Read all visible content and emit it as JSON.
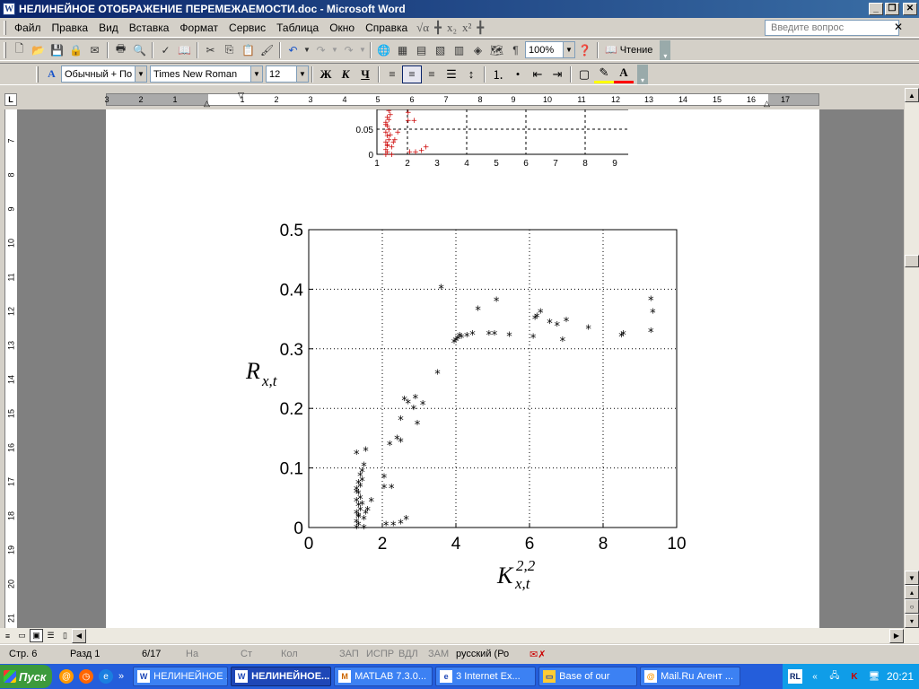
{
  "window": {
    "title": "НЕЛИНЕЙНОЕ ОТОБРАЖЕНИЕ ПЕРЕМЕЖАЕМОСТИ.doc - Microsoft Word",
    "app_icon": "W",
    "minimize": "_",
    "maximize": "❐",
    "close": "✕"
  },
  "menu": {
    "items": [
      "Файл",
      "Правка",
      "Вид",
      "Вставка",
      "Формат",
      "Сервис",
      "Таблица",
      "Окно",
      "Справка"
    ],
    "ask_placeholder": "Введите вопрос",
    "close_doc": "✕"
  },
  "toolbar_standard": {
    "zoom": "100%",
    "read_label": "Чтение"
  },
  "toolbar_format": {
    "style": "Обычный + По ц",
    "font": "Times New Roman",
    "size": "12",
    "bold": "Ж",
    "italic": "К",
    "underline": "Ч"
  },
  "ruler": {
    "tab_selector": "L",
    "h_numbers": [
      "3",
      "2",
      "1",
      "",
      "1",
      "2",
      "3",
      "4",
      "5",
      "6",
      "7",
      "8",
      "9",
      "10",
      "11",
      "12",
      "13",
      "14",
      "15",
      "16",
      "17"
    ],
    "v_numbers": [
      "7",
      "8",
      "9",
      "10",
      "11",
      "12",
      "13",
      "14",
      "15",
      "16",
      "17",
      "18",
      "19",
      "20",
      "21"
    ]
  },
  "small_chart": {
    "y_ticks": [
      "0.05",
      "0"
    ],
    "x_ticks": [
      "1",
      "2",
      "3",
      "4",
      "5",
      "6",
      "7",
      "8",
      "9",
      "10"
    ],
    "color": "#cc0000"
  },
  "chart_data": {
    "type": "scatter",
    "title": "",
    "xlabel": "K",
    "xlabel_sup": "2,2",
    "xlabel_sub": "x,t",
    "ylabel": "R",
    "ylabel_sub": "x,t",
    "xlim": [
      0,
      10
    ],
    "ylim": [
      0,
      0.5
    ],
    "x_ticks": [
      "0",
      "2",
      "4",
      "6",
      "8",
      "10"
    ],
    "y_ticks": [
      "0",
      "0.1",
      "0.2",
      "0.3",
      "0.4",
      "0.5"
    ],
    "grid": "dotted",
    "marker": "*",
    "color": "#000000",
    "series": [
      {
        "points": [
          [
            1.3,
            0.0
          ],
          [
            1.35,
            0.005
          ],
          [
            1.3,
            0.01
          ],
          [
            1.35,
            0.018
          ],
          [
            1.3,
            0.025
          ],
          [
            1.4,
            0.03
          ],
          [
            1.35,
            0.038
          ],
          [
            1.3,
            0.045
          ],
          [
            1.4,
            0.05
          ],
          [
            1.35,
            0.058
          ],
          [
            1.3,
            0.065
          ],
          [
            1.4,
            0.07
          ],
          [
            1.35,
            0.075
          ],
          [
            1.45,
            0.08
          ],
          [
            1.4,
            0.088
          ],
          [
            1.45,
            0.095
          ],
          [
            1.5,
            0.105
          ],
          [
            1.3,
            0.125
          ],
          [
            1.55,
            0.13
          ],
          [
            1.5,
            0.0
          ],
          [
            1.5,
            0.015
          ],
          [
            1.55,
            0.025
          ],
          [
            1.6,
            0.03
          ],
          [
            1.7,
            0.045
          ],
          [
            1.45,
            0.04
          ],
          [
            1.3,
            0.06
          ],
          [
            1.35,
            0.02
          ],
          [
            2.05,
            0.085
          ],
          [
            2.05,
            0.068
          ],
          [
            2.25,
            0.068
          ],
          [
            2.2,
            0.14
          ],
          [
            2.4,
            0.15
          ],
          [
            2.5,
            0.145
          ],
          [
            2.5,
            0.182
          ],
          [
            2.6,
            0.215
          ],
          [
            2.7,
            0.21
          ],
          [
            2.85,
            0.2
          ],
          [
            2.9,
            0.218
          ],
          [
            2.95,
            0.175
          ],
          [
            3.1,
            0.208
          ],
          [
            3.5,
            0.26
          ],
          [
            2.1,
            0.005
          ],
          [
            2.3,
            0.005
          ],
          [
            2.5,
            0.008
          ],
          [
            2.65,
            0.015
          ],
          [
            3.6,
            0.403
          ],
          [
            3.95,
            0.312
          ],
          [
            4.0,
            0.315
          ],
          [
            4.05,
            0.318
          ],
          [
            4.1,
            0.322
          ],
          [
            4.15,
            0.32
          ],
          [
            4.3,
            0.322
          ],
          [
            4.45,
            0.325
          ],
          [
            4.6,
            0.367
          ],
          [
            4.9,
            0.325
          ],
          [
            5.05,
            0.325
          ],
          [
            5.1,
            0.382
          ],
          [
            5.45,
            0.323
          ],
          [
            6.1,
            0.32
          ],
          [
            6.15,
            0.352
          ],
          [
            6.2,
            0.355
          ],
          [
            6.3,
            0.362
          ],
          [
            6.55,
            0.345
          ],
          [
            6.75,
            0.34
          ],
          [
            6.9,
            0.315
          ],
          [
            7.0,
            0.348
          ],
          [
            7.6,
            0.335
          ],
          [
            8.5,
            0.322
          ],
          [
            8.55,
            0.325
          ],
          [
            9.3,
            0.383
          ],
          [
            9.35,
            0.362
          ],
          [
            9.3,
            0.33
          ]
        ]
      }
    ]
  },
  "status": {
    "page": "Стр. 6",
    "section": "Разд 1",
    "pages": "6/17",
    "at": "На",
    "line": "Ст",
    "col": "Кол",
    "rec": "ЗАП",
    "trk": "ИСПР",
    "ext": "ВДЛ",
    "ovr": "ЗАМ",
    "lang": "русский (Ро"
  },
  "taskbar": {
    "start": "Пуск",
    "tasks": [
      {
        "label": "НЕЛИНЕЙНОЕ ...",
        "icon": "W",
        "active": false
      },
      {
        "label": "НЕЛИНЕЙНОЕ...",
        "icon": "W",
        "active": true
      },
      {
        "label": "MATLAB 7.3.0...",
        "icon": "M",
        "active": false
      },
      {
        "label": "3 Internet Ex...",
        "icon": "e",
        "active": false
      },
      {
        "label": "Base of our",
        "icon": "▭",
        "active": false
      },
      {
        "label": "Mail.Ru Агент ...",
        "icon": "@",
        "active": false
      }
    ],
    "lang": "RL",
    "expand": "«",
    "clock": "20:21"
  }
}
